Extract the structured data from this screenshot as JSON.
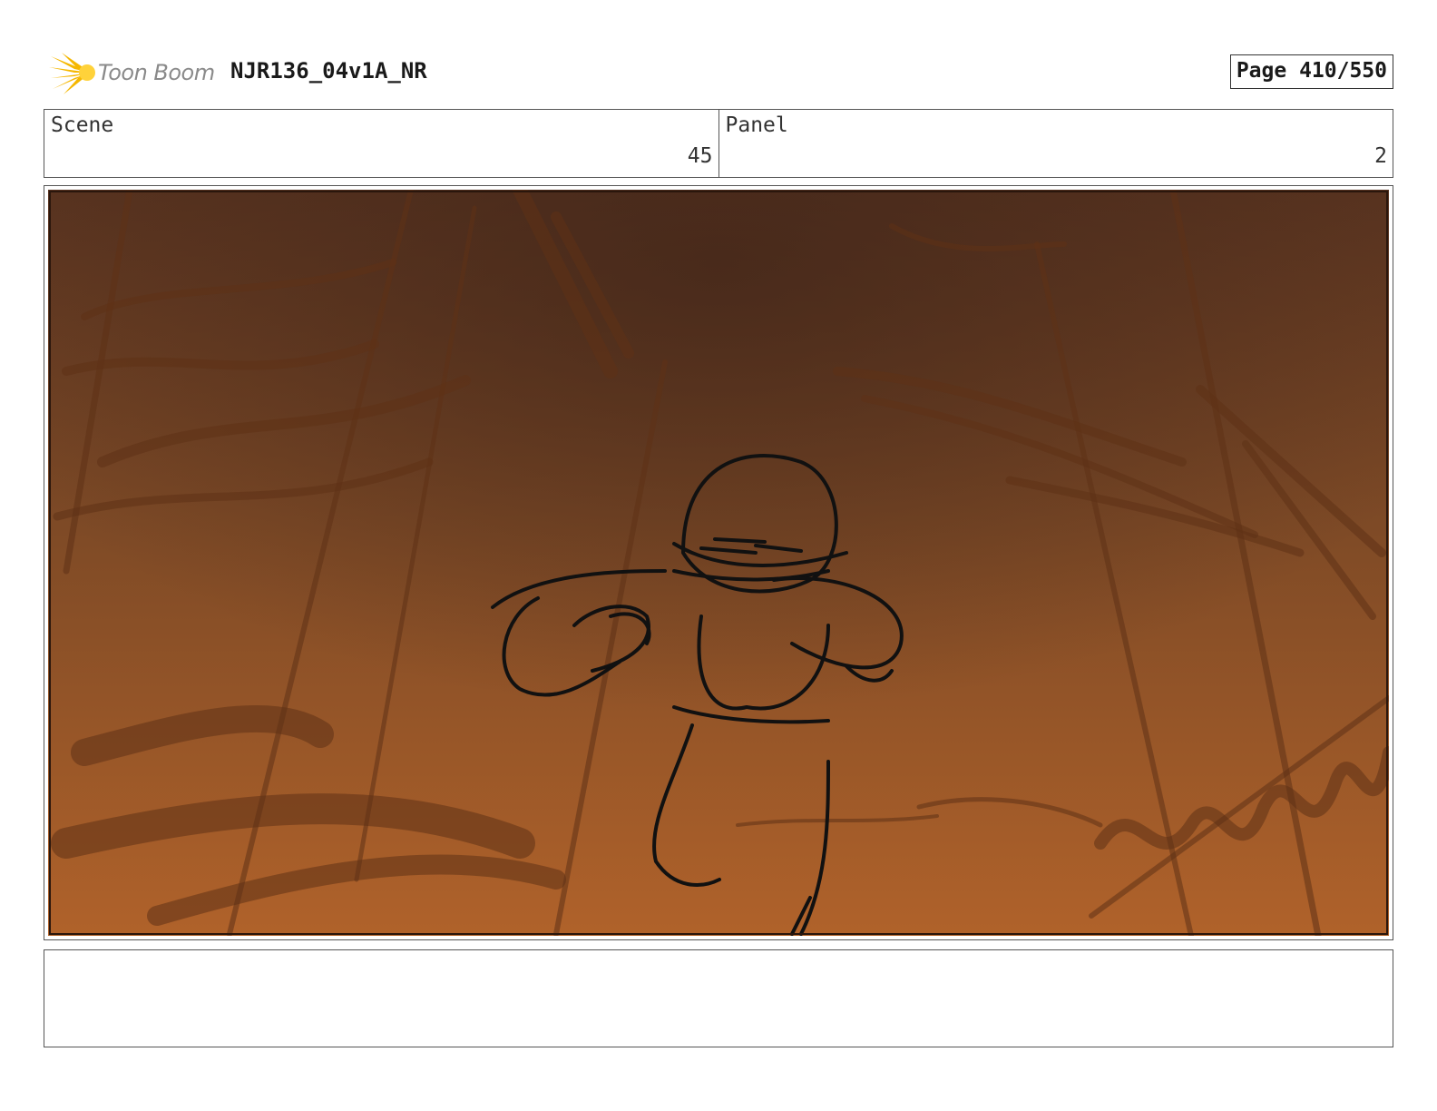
{
  "header": {
    "brand": "Toon Boom",
    "logo_icon": "toon-boom-starburst-icon",
    "project_title": "NJR136_04v1A_NR",
    "page_indicator": "Page 410/550"
  },
  "info": {
    "scene_label": "Scene",
    "scene_value": "45",
    "panel_label": "Panel",
    "panel_value": "2"
  },
  "panel": {
    "content": "sketch-drawing-icon"
  },
  "notes": {
    "text": ""
  },
  "colors": {
    "accent": "#F5B700",
    "sky_light": "#B8692A",
    "sky_dark": "#4A2A18",
    "line": "#111111"
  }
}
